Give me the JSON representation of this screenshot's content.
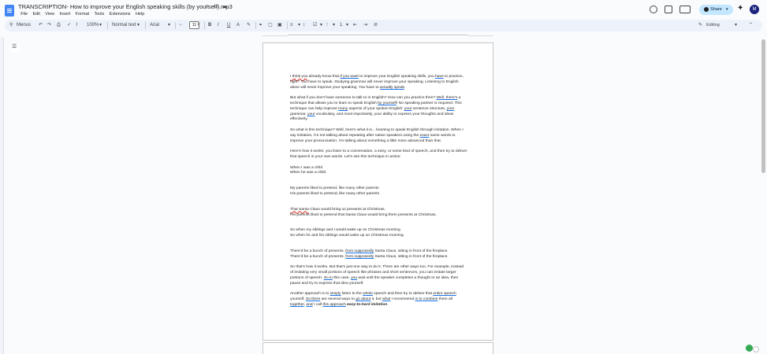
{
  "title_bar": {
    "doc_title": "TRANSCRIPTION- How to improve your English speaking skills (by yourself).mp3",
    "icons": [
      "star-icon",
      "move-folder-icon",
      "cloud-status-icon"
    ],
    "menu": [
      "File",
      "Edit",
      "View",
      "Insert",
      "Format",
      "Tools",
      "Extensions",
      "Help"
    ],
    "share_label": "Share",
    "avatar_initial": "M"
  },
  "toolbar": {
    "search_placeholder": "Menus",
    "zoom": "100%",
    "style": "Normal text",
    "font": "Arial",
    "font_size": "11",
    "mode": "Editing"
  },
  "document": {
    "paragraphs": [
      [
        [
          "I think you",
          "red"
        ],
        [
          " already know that ",
          ""
        ],
        [
          "if you want",
          "ul"
        ],
        [
          " to improve your English speaking skills, you ",
          ""
        ],
        [
          "have",
          "ul"
        ],
        [
          " to practice, right? You have to speak. Studying grammar will never improve your speaking. Listening to English alone will never improve your speaking. You have to ",
          ""
        ],
        [
          "actually speak",
          "ul"
        ],
        [
          ".",
          ""
        ]
      ],
      [
        [
          "But what if you don't have someone to talk to in English? How can you practice then? ",
          ""
        ],
        [
          "Well, there's",
          "ul"
        ],
        [
          " a technique that allows you to learn to speak English ",
          ""
        ],
        [
          "by yourself",
          "ul"
        ],
        [
          "! No speaking partner is required. This technique can help improve ",
          ""
        ],
        [
          "many",
          "ul"
        ],
        [
          " aspects of your spoken English: ",
          ""
        ],
        [
          "your",
          "ul"
        ],
        [
          " sentence structure, ",
          ""
        ],
        [
          "your",
          "ul"
        ],
        [
          " grammar, ",
          ""
        ],
        [
          "your",
          "ul"
        ],
        [
          " vocabulary, and most importantly, your ability to express your thoughts and ideas effectively.",
          ""
        ]
      ],
      [
        [
          "So what is this technique? Well, here's what it is... learning to speak English through imitation. When I say imitation, I'm not talking about repeating after native speakers using the ",
          ""
        ],
        [
          "exact",
          "ul"
        ],
        [
          " same words to improve your pronunciation. I'm talking about something a little more advanced than that.",
          ""
        ]
      ],
      [
        [
          "Here's how it works: you listen to a conversation, a story, or some kind of speech, and then try to deliver that speech in your own words. Let's see this technique in action:",
          ""
        ]
      ],
      [
        [
          "When I was a child",
          ""
        ],
        [
          "\nWhen he was a child",
          ""
        ]
      ],
      [
        [
          "My parents liked to pretend, like many other parents",
          ""
        ],
        [
          "\nHis parents liked to pretend, like many other parents",
          ""
        ]
      ],
      [
        [
          "That Santa",
          "red"
        ],
        [
          " Claus would bring us presents at Christmas.",
          ""
        ],
        [
          "\nHis parents liked to pretend that Santa Claus would bring them presents at Christmas.",
          ""
        ]
      ],
      [
        [
          "So when my siblings and I would wake up on Christmas morning",
          ""
        ],
        [
          "\nSo when he and his siblings would wake up on Christmas morning.",
          ""
        ]
      ],
      [
        [
          "There'd be a bunch of presents, ",
          ""
        ],
        [
          "from supposedly",
          "ul"
        ],
        [
          " Santa Claus, sitting in front of the fireplace.",
          ""
        ],
        [
          "\nThere'd be a bunch of presents, ",
          ""
        ],
        [
          "from supposedly",
          "ul"
        ],
        [
          " Santa Claus, sitting in front of the fireplace.",
          ""
        ]
      ],
      [
        [
          "So that's how it works. But that's just one way to do it. There are other ways too. For example, instead of imitating very small portions of speech like phrases and short sentences, you can imitate larger portions of speech. ",
          ""
        ],
        [
          "So in",
          "ul"
        ],
        [
          " this case, ",
          ""
        ],
        [
          "you",
          "ul"
        ],
        [
          " wait until the speaker completes a thought or an idea, then pause and try to express that idea yourself.",
          ""
        ]
      ],
      [
        [
          "Another approach is to ",
          ""
        ],
        [
          "simply",
          "ul"
        ],
        [
          " listen to the ",
          ""
        ],
        [
          "whole",
          "ul"
        ],
        [
          " speech and then try to deliver that ",
          ""
        ],
        [
          "entire speech",
          "ul"
        ],
        [
          " yourself. ",
          ""
        ],
        [
          "So there",
          "ul"
        ],
        [
          " are several ways to ",
          ""
        ],
        [
          "go about",
          "ul"
        ],
        [
          " it, but ",
          ""
        ],
        [
          "what",
          "ul"
        ],
        [
          " I recommend ",
          ""
        ],
        [
          "is to combine",
          "ul"
        ],
        [
          " them all ",
          ""
        ],
        [
          "together",
          "ul"
        ],
        [
          ", ",
          ""
        ],
        [
          "and",
          "ul"
        ],
        [
          " I call ",
          ""
        ],
        [
          "this approach",
          "ul"
        ],
        [
          " ",
          ""
        ],
        [
          "easy-to-hard imitation",
          "bi"
        ],
        [
          ".",
          ""
        ]
      ]
    ]
  }
}
